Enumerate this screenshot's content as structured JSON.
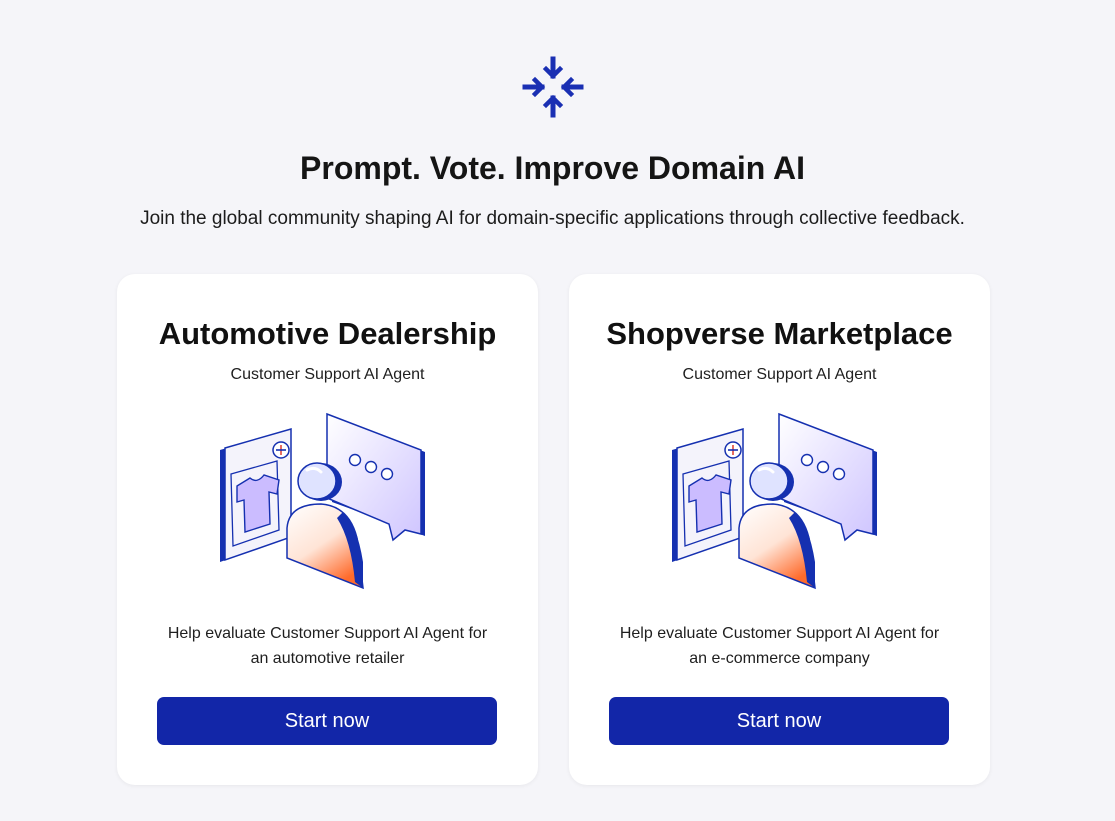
{
  "header": {
    "logo_icon": "snowflake-arrows-icon",
    "title": "Prompt. Vote. Improve Domain AI",
    "subtitle": "Join the global community shaping AI for domain-specific applications through collective feedback."
  },
  "cards": [
    {
      "title": "Automotive Dealership",
      "subtitle": "Customer Support AI Agent",
      "illustration": "customer-support-illustration",
      "desc_line1": "Help evaluate Customer Support AI Agent for",
      "desc_line2": "an automotive retailer",
      "button_label": "Start now"
    },
    {
      "title": "Shopverse Marketplace",
      "subtitle": "Customer Support AI Agent",
      "illustration": "customer-support-illustration",
      "desc_line1": "Help evaluate Customer Support AI Agent for",
      "desc_line2": "an e-commerce company",
      "button_label": "Start now"
    }
  ],
  "colors": {
    "background": "#f5f5f9",
    "primary": "#1226a8",
    "card": "#ffffff",
    "illustration_lavender": "#d9d2ff",
    "illustration_orange": "#ff7a3c"
  }
}
